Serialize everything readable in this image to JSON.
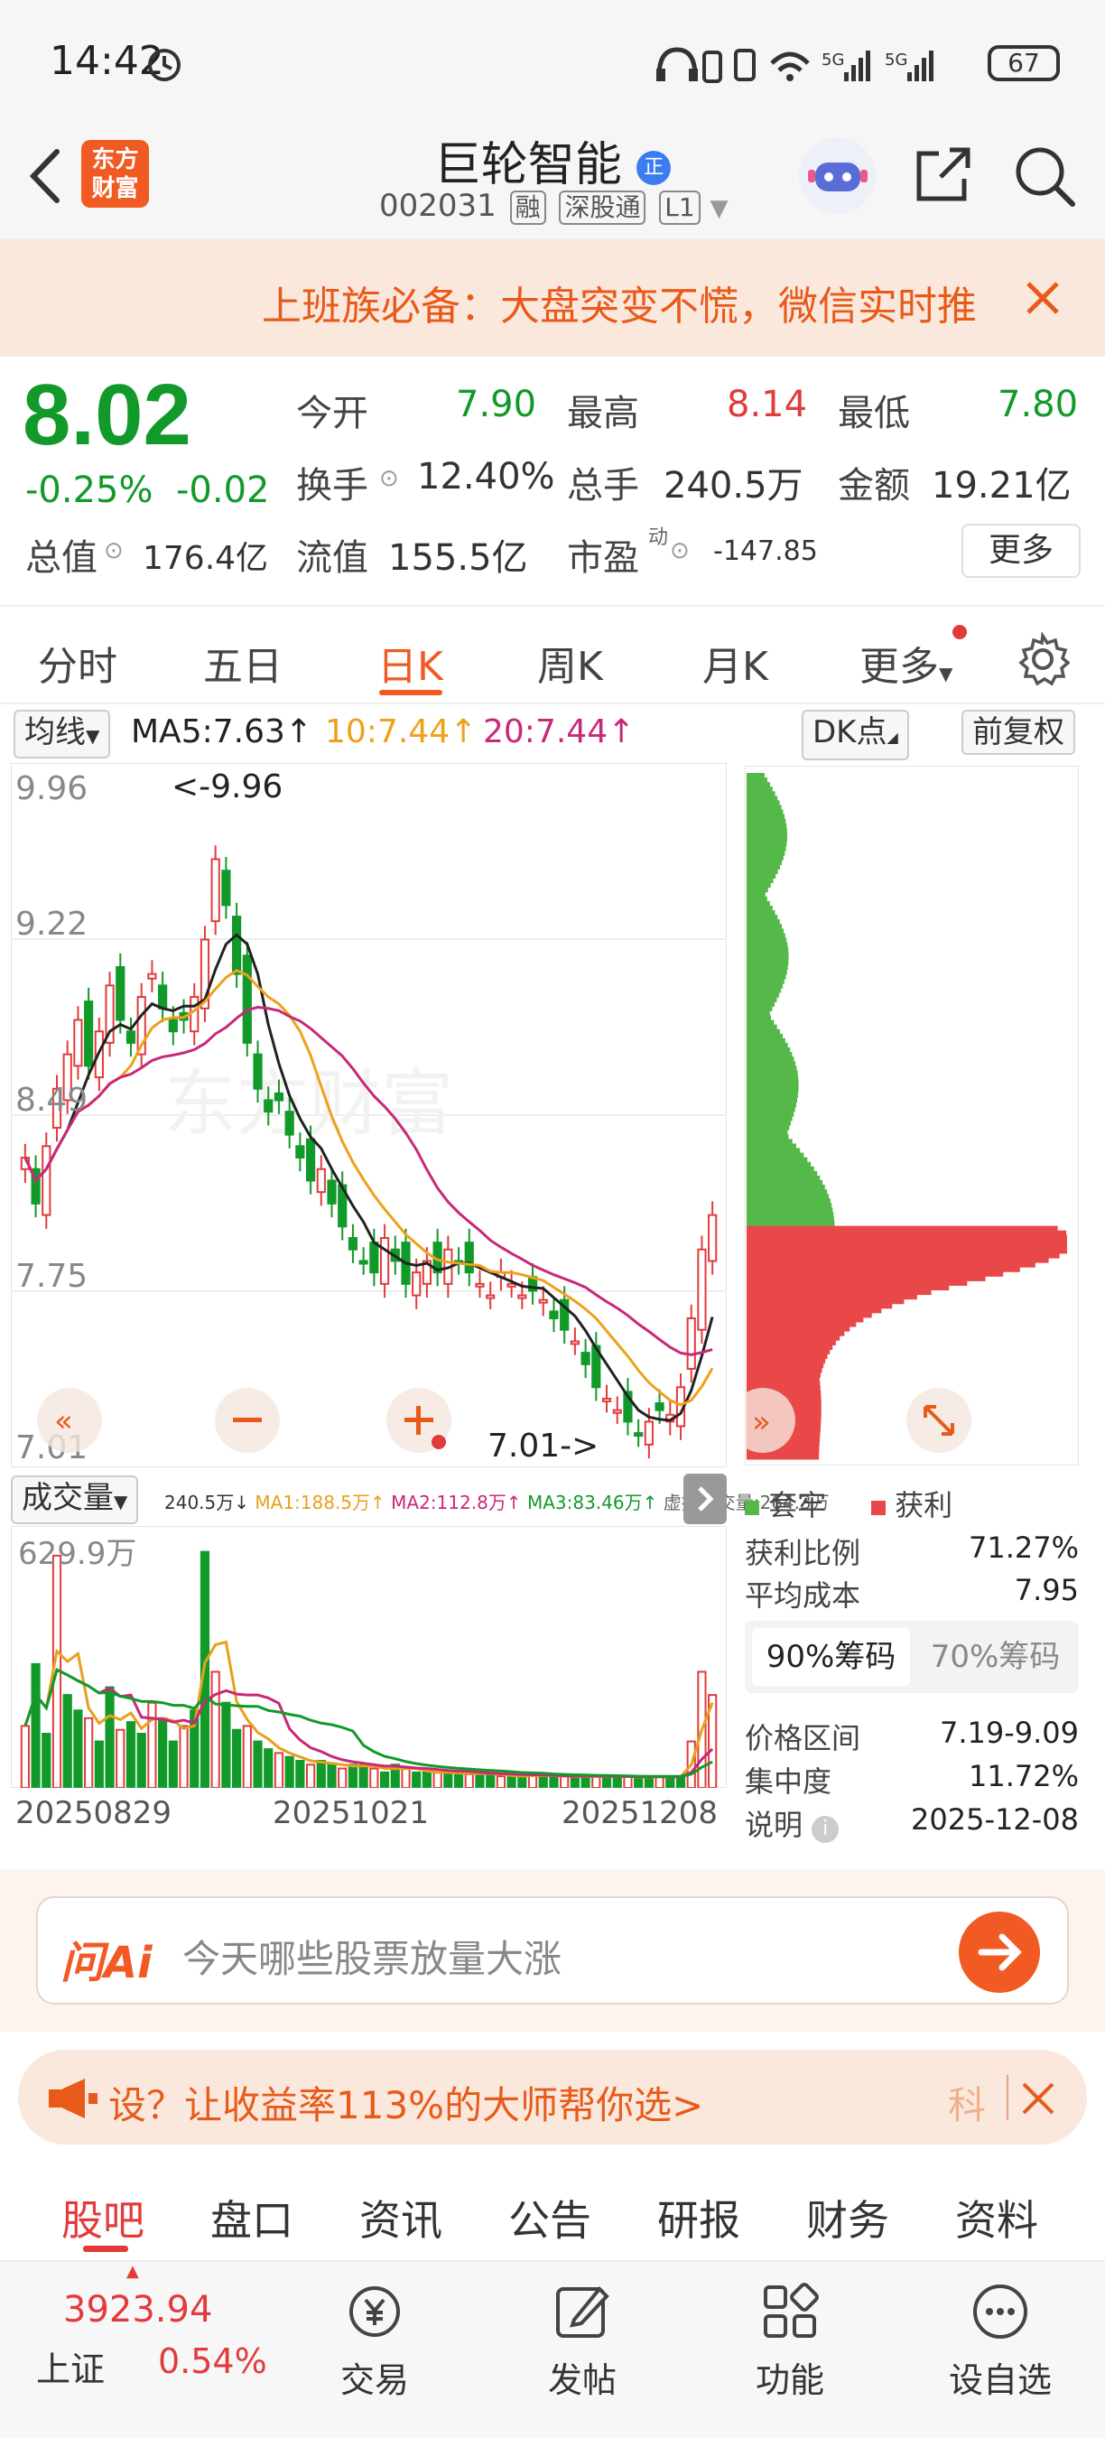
{
  "status_bar": {
    "time": "14:42",
    "battery": "67"
  },
  "header": {
    "logo_line1": "东方",
    "logo_line2": "财富",
    "stock_name": "巨轮智能",
    "name_badge": "正",
    "stock_code": "002031",
    "tags": [
      "融",
      "深股通",
      "L1"
    ]
  },
  "banner": {
    "text": "上班族必备：大盘突变不慌，微信实时推"
  },
  "quote": {
    "price": "8.02",
    "change_pct": "-0.25%",
    "change_val": "-0.02",
    "open_label": "今开",
    "open_val": "7.90",
    "high_label": "最高",
    "high_val": "8.14",
    "low_label": "最低",
    "low_val": "7.80",
    "turnover_label": "换手",
    "turnover_val": "12.40%",
    "volume_label": "总手",
    "volume_val": "240.5万",
    "amount_label": "金额",
    "amount_val": "19.21亿",
    "mktcap_label": "总值",
    "mktcap_val": "176.4亿",
    "float_label": "流值",
    "float_val": "155.5亿",
    "pe_label": "市盈",
    "pe_sup": "动",
    "pe_val": "-147.85",
    "more_label": "更多"
  },
  "chart_tabs": [
    "分时",
    "五日",
    "日K",
    "周K",
    "月K",
    "更多"
  ],
  "active_chart_tab": "日K",
  "ma_row": {
    "selector": "均线",
    "ma5": "MA5:7.63↑",
    "ma10": "10:7.44↑",
    "ma20": "20:7.44↑",
    "dk_btn": "DK点",
    "adjust_btn": "前复权"
  },
  "kline": {
    "y_labels": [
      "9.96",
      "9.22",
      "8.49",
      "7.75",
      "7.01"
    ],
    "max_marker": "<-9.96",
    "min_marker": "7.01->",
    "watermark": "东方财富"
  },
  "volume": {
    "selector": "成交量",
    "info_total": "240.5万↓",
    "info_ma1": "MA1:188.5万↑",
    "info_ma2": "MA2:112.8万↑",
    "info_ma3": "MA3:83.46万↑",
    "info_virtual": "虚拟成交量:264.3万",
    "y_max": "629.9万",
    "dates": [
      "20250829",
      "20251021",
      "20251208"
    ]
  },
  "chip": {
    "legend_trapped": "套牢",
    "legend_profit": "获利",
    "profit_ratio_label": "获利比例",
    "profit_ratio_val": "71.27%",
    "avg_cost_label": "平均成本",
    "avg_cost_val": "7.95",
    "tab_90": "90%筹码",
    "tab_70": "70%筹码",
    "range_label": "价格区间",
    "range_val": "7.19-9.09",
    "concentration_label": "集中度",
    "concentration_val": "11.72%",
    "note_label": "说明",
    "note_val": "2025-12-08"
  },
  "ai": {
    "logo": "问Ai",
    "placeholder": "今天哪些股票放量大涨"
  },
  "promo": {
    "text": "设？让收益率113%的大师帮你选>",
    "right_tag": "科"
  },
  "bottom_tabs": [
    "股吧",
    "盘口",
    "资讯",
    "公告",
    "研报",
    "财务",
    "资料"
  ],
  "bottom_nav": {
    "index_value": "3923.94",
    "index_name": "上证",
    "index_change": "0.54%",
    "items": [
      "交易",
      "发帖",
      "功能",
      "设自选"
    ]
  },
  "colors": {
    "up": "#e23b3b",
    "down": "#119a2a",
    "accent": "#f15a22"
  }
}
